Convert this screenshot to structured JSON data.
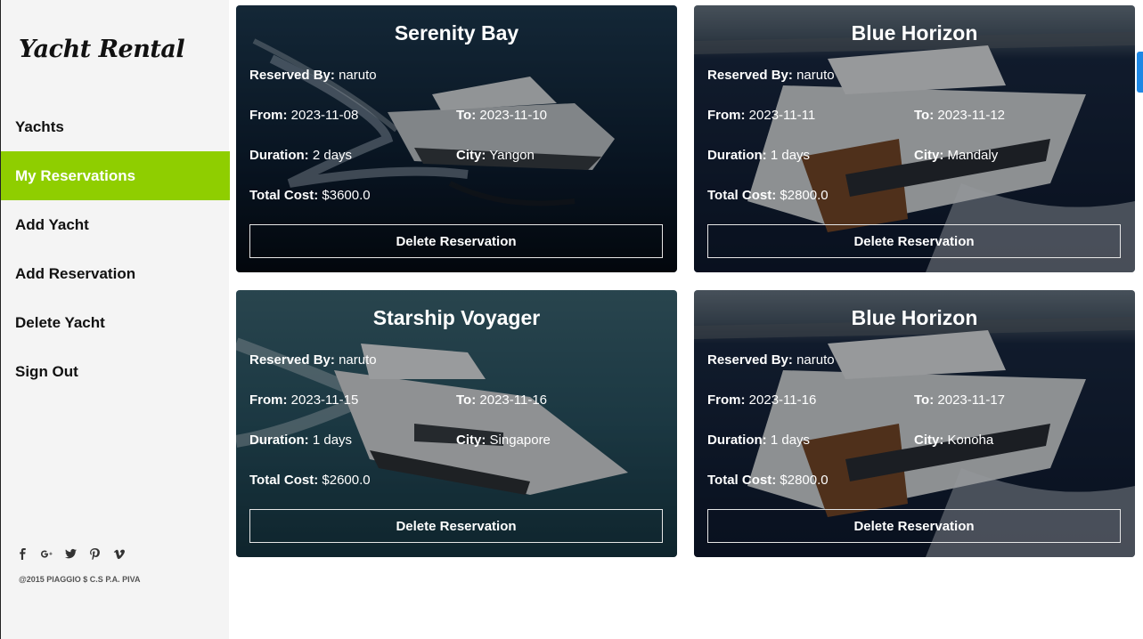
{
  "sidebar": {
    "logo": "Yacht Rental",
    "items": [
      {
        "label": "Yachts"
      },
      {
        "label": "My Reservations",
        "active": true
      },
      {
        "label": "Add Yacht"
      },
      {
        "label": "Add Reservation"
      },
      {
        "label": "Delete Yacht"
      },
      {
        "label": "Sign Out"
      }
    ],
    "social_icons": [
      "facebook-icon",
      "google-plus-icon",
      "twitter-icon",
      "pinterest-icon",
      "vimeo-icon"
    ],
    "copyright": "@2015 PIAGGIO $ C.S P.A. PIVA"
  },
  "labels": {
    "reserved_by": "Reserved By:",
    "from": "From:",
    "to": "To:",
    "duration": "Duration:",
    "city": "City:",
    "total_cost": "Total Cost:",
    "delete_button": "Delete Reservation"
  },
  "reservations": [
    {
      "title": "Serenity Bay",
      "reserved_by": "naruto",
      "from": "2023-11-08",
      "to": "2023-11-10",
      "duration": "2 days",
      "city": "Yangon",
      "total_cost": "$3600.0"
    },
    {
      "title": "Blue Horizon",
      "reserved_by": "naruto",
      "from": "2023-11-11",
      "to": "2023-11-12",
      "duration": "1 days",
      "city": "Mandaly",
      "total_cost": "$2800.0"
    },
    {
      "title": "Starship Voyager",
      "reserved_by": "naruto",
      "from": "2023-11-15",
      "to": "2023-11-16",
      "duration": "1 days",
      "city": "Singapore",
      "total_cost": "$2600.0"
    },
    {
      "title": "Blue Horizon",
      "reserved_by": "naruto",
      "from": "2023-11-16",
      "to": "2023-11-17",
      "duration": "1 days",
      "city": "Konoha",
      "total_cost": "$2800.0"
    }
  ],
  "colors": {
    "accent": "#8fce00",
    "sidebar_bg": "#f4f4f4"
  }
}
